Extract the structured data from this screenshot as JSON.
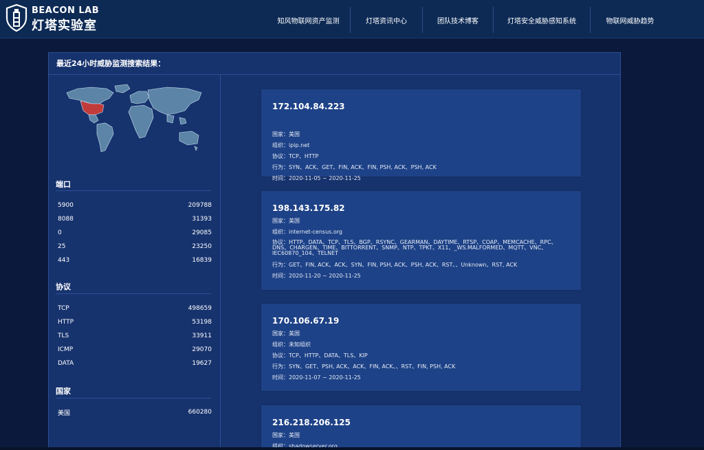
{
  "brand": {
    "en": "BEACON LAB",
    "cn": "灯塔实验室"
  },
  "nav": [
    {
      "label": "知风物联网资产监测"
    },
    {
      "label": "灯塔资讯中心"
    },
    {
      "label": "团队技术博客"
    },
    {
      "label": "灯塔安全威胁感知系统"
    },
    {
      "label": "物联网威胁趋势"
    }
  ],
  "panel": {
    "title": "最近24小时威胁监测搜索结果："
  },
  "sidebar": {
    "ports_title": "端口",
    "ports": [
      {
        "name": "5900",
        "count": "209788"
      },
      {
        "name": "8088",
        "count": "31393"
      },
      {
        "name": "0",
        "count": "29085"
      },
      {
        "name": "25",
        "count": "23250"
      },
      {
        "name": "443",
        "count": "16839"
      }
    ],
    "protocols_title": "协议",
    "protocols": [
      {
        "name": "TCP",
        "count": "498659"
      },
      {
        "name": "HTTP",
        "count": "53198"
      },
      {
        "name": "TLS",
        "count": "33911"
      },
      {
        "name": "ICMP",
        "count": "29070"
      },
      {
        "name": "DATA",
        "count": "19627"
      }
    ],
    "countries_title": "国家",
    "countries": [
      {
        "name": "美国",
        "count": "660280"
      }
    ]
  },
  "labels": {
    "country": "国家：",
    "org": "组织：",
    "protocol": "协议：",
    "behavior": "行为：",
    "time": "时间："
  },
  "results": [
    {
      "ip": "172.104.84.223",
      "country": "美国",
      "org": "ipip.net",
      "protocol": "TCP、HTTP",
      "behavior": "SYN、ACK、GET、FIN, ACK、FIN, PSH, ACK、PSH, ACK",
      "time": "2020-11-05 ~ 2020-11-25"
    },
    {
      "ip": "198.143.175.82",
      "country": "美国",
      "org": "internet-census.org",
      "protocol": "HTTP、DATA、TCP、TLS、BGP、RSYNC、GEARMAN、DAYTIME、RTSP、COAP、MEMCACHE、RPC、DNS、CHARGEN、TIME、BITTORRENT、SNMP、NTP、TPKT、X11、_WS.MALFORMED、MQTT、VNC、IEC60870_104、TELNET",
      "behavior": "GET、FIN, ACK、ACK、SYN、FIN, PSH, ACK、PSH, ACK、RST、、Unknown、RST, ACK",
      "time": "2020-11-20 ~ 2020-11-25"
    },
    {
      "ip": "170.106.67.19",
      "country": "美国",
      "org": "未知组织",
      "protocol": "TCP、HTTP、DATA、TLS、KIP",
      "behavior": "SYN、GET、PSH, ACK、ACK、FIN, ACK、、RST、FIN, PSH, ACK",
      "time": "2020-11-07 ~ 2020-11-25"
    },
    {
      "ip": "216.218.206.125",
      "country": "美国",
      "org": "shadowserver.org"
    }
  ]
}
